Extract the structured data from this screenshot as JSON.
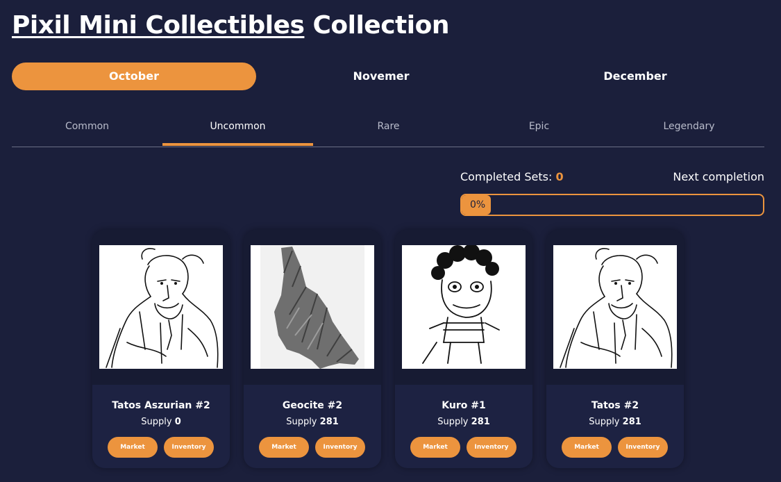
{
  "title": {
    "link": "Pixil Mini Collectibles",
    "suffix": "Collection"
  },
  "months": [
    {
      "label": "October",
      "active": true
    },
    {
      "label": "Novemer",
      "active": false
    },
    {
      "label": "December",
      "active": false
    }
  ],
  "rarities": [
    {
      "label": "Common",
      "active": false
    },
    {
      "label": "Uncommon",
      "active": true
    },
    {
      "label": "Rare",
      "active": false
    },
    {
      "label": "Epic",
      "active": false
    },
    {
      "label": "Legendary",
      "active": false
    }
  ],
  "progress": {
    "completed_label": "Completed Sets:",
    "completed_value": "0",
    "next_label": "Next completion",
    "percent_text": "0%",
    "percent": 0
  },
  "cards": [
    {
      "name": "Tatos Aszurian #2",
      "supply_label": "Supply",
      "supply": "0",
      "art": "man-sketch-icon",
      "market": "Market",
      "inventory": "Inventory"
    },
    {
      "name": "Geocite #2",
      "supply_label": "Supply",
      "supply": "281",
      "art": "crystal-rock-icon",
      "market": "Market",
      "inventory": "Inventory"
    },
    {
      "name": "Kuro #1",
      "supply_label": "Supply",
      "supply": "281",
      "art": "frog-samurai-icon",
      "market": "Market",
      "inventory": "Inventory"
    },
    {
      "name": "Tatos #2",
      "supply_label": "Supply",
      "supply": "281",
      "art": "man-sketch-icon",
      "market": "Market",
      "inventory": "Inventory"
    }
  ],
  "colors": {
    "background": "#1b1f3b",
    "accent": "#ec943e",
    "card": "#1d2242"
  }
}
